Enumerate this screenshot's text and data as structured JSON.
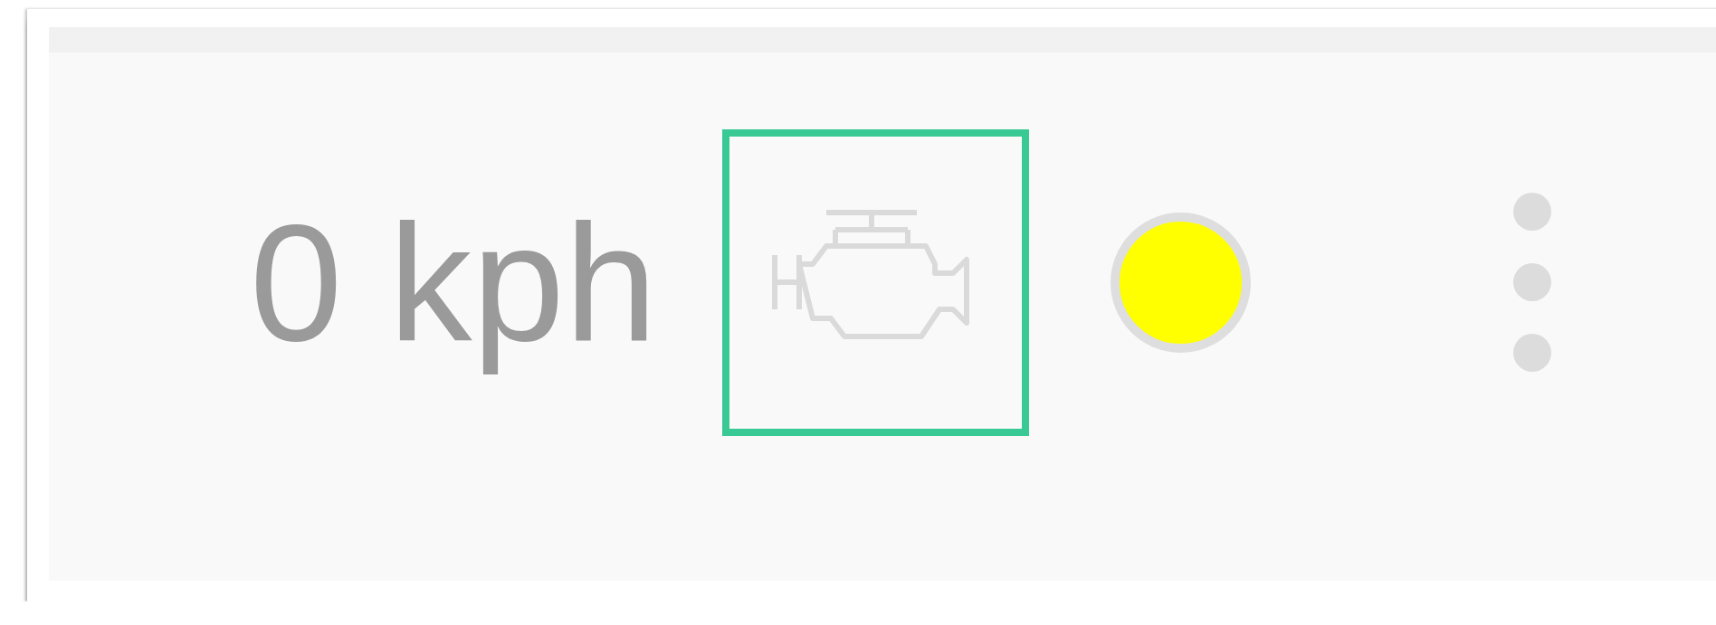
{
  "speed": "0 kph",
  "engine_indicator": {
    "highlighted": true
  },
  "status_dot": {
    "color": "#ffff00"
  }
}
